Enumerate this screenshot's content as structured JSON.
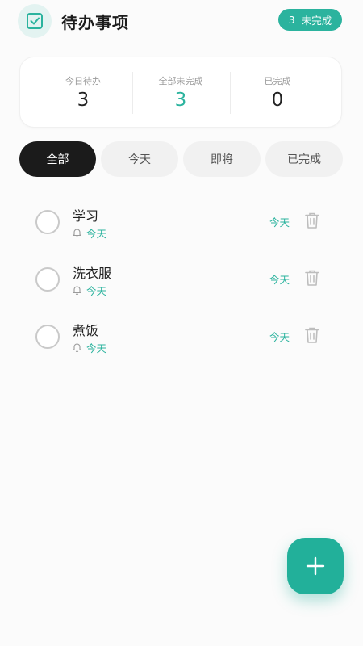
{
  "header": {
    "title": "待办事项",
    "badge_count": "3",
    "badge_label": "未完成"
  },
  "stats": [
    {
      "label": "今日待办",
      "value": "3"
    },
    {
      "label": "全部未完成",
      "value": "3"
    },
    {
      "label": "已完成",
      "value": "0"
    }
  ],
  "tabs": [
    {
      "label": "全部",
      "active": true
    },
    {
      "label": "今天",
      "active": false
    },
    {
      "label": "即将",
      "active": false
    },
    {
      "label": "已完成",
      "active": false
    }
  ],
  "tasks": [
    {
      "title": "学习",
      "reminder": "今天",
      "due": "今天"
    },
    {
      "title": "洗衣服",
      "reminder": "今天",
      "due": "今天"
    },
    {
      "title": "煮饭",
      "reminder": "今天",
      "due": "今天"
    }
  ],
  "colors": {
    "accent": "#2bb39e",
    "dark": "#1b1b1b"
  },
  "icons": {
    "app": "checkbox-icon",
    "add": "plus-icon",
    "delete": "trash-icon",
    "reminder": "bell-icon"
  }
}
